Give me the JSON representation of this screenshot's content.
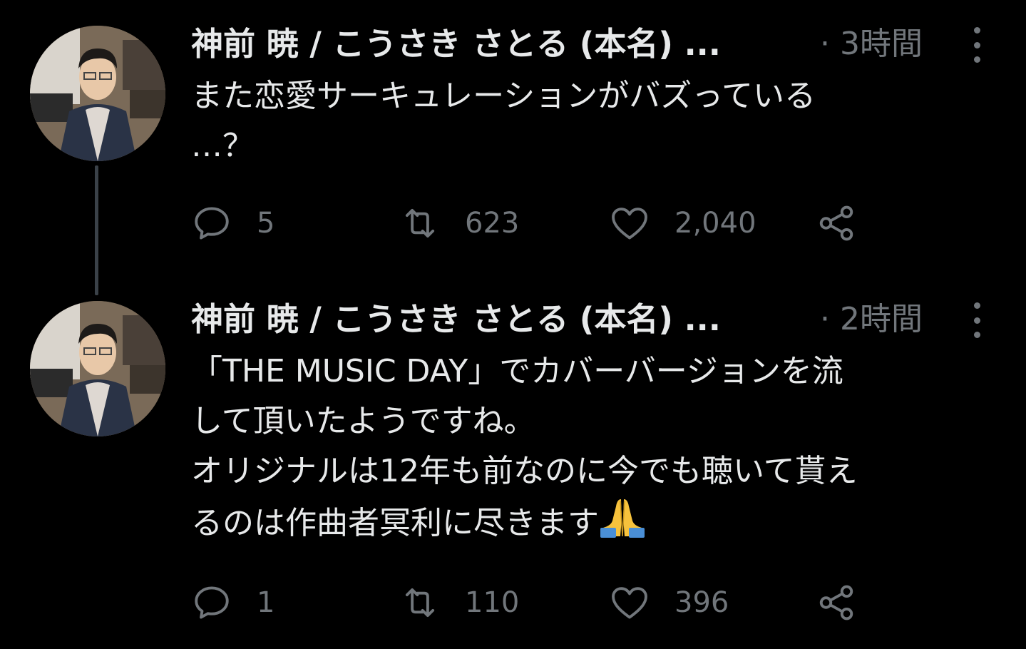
{
  "colors": {
    "background": "#000000",
    "text": "#e7e9ea",
    "secondary": "#71767b",
    "thread_line": "#3a4148"
  },
  "tweets": [
    {
      "author": "神前 暁 / こうさき さとる (本名) ...",
      "time": "· 3時間",
      "text": "また恋愛サーキュレーションがバズっている\n…？",
      "reply_count": "5",
      "retweet_count": "623",
      "like_count": "2,040",
      "icons": [
        "reply-icon",
        "retweet-icon",
        "like-icon",
        "share-icon",
        "more-icon"
      ]
    },
    {
      "author": "神前 暁 / こうさき さとる (本名) ...",
      "time": "· 2時間",
      "text": "「THE MUSIC DAY」でカバーバージョンを流\nして頂いたようですね。\nオリジナルは12年も前なのに今でも聴いて貰え\nるのは作曲者冥利に尽きます",
      "emoji": "folded-hands",
      "reply_count": "1",
      "retweet_count": "110",
      "like_count": "396",
      "icons": [
        "reply-icon",
        "retweet-icon",
        "like-icon",
        "share-icon",
        "more-icon"
      ]
    }
  ]
}
